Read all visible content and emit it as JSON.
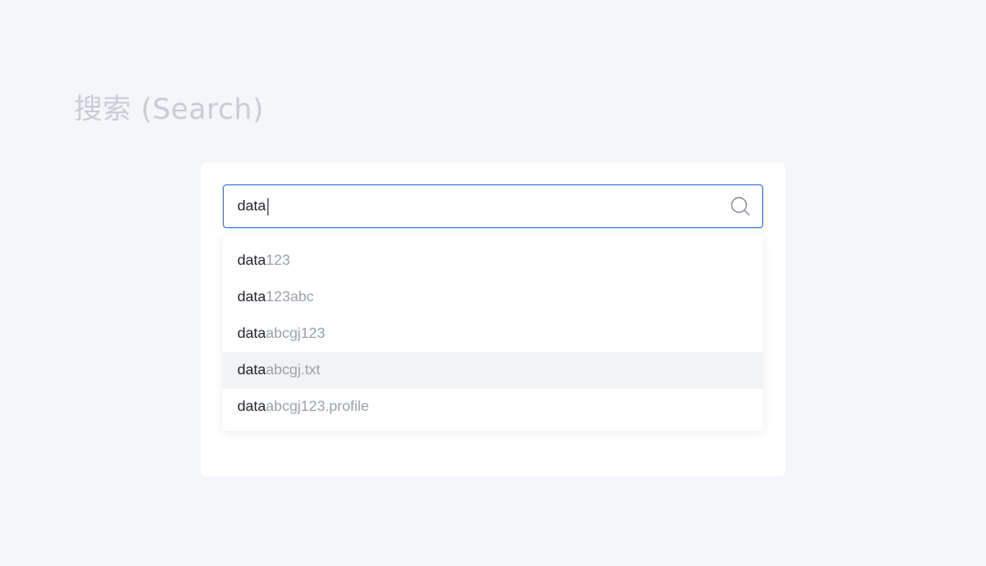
{
  "page": {
    "title": "搜索 (Search)"
  },
  "search": {
    "value": "data",
    "icon": "search-icon"
  },
  "dropdown": {
    "highlighted_index": 3,
    "options": [
      {
        "match": "data",
        "rest": "123"
      },
      {
        "match": "data",
        "rest": "123abc"
      },
      {
        "match": "data",
        "rest": "abcgj123"
      },
      {
        "match": "data",
        "rest": "abcgj.txt"
      },
      {
        "match": "data",
        "rest": "abcgj123.profile"
      }
    ]
  },
  "colors": {
    "background": "#f4f6fa",
    "accent_border": "#2f6fdb",
    "match_text": "#1f2329",
    "rest_text": "#9aa0a8",
    "title_text": "#c9ccd2",
    "hover_bg": "#f2f3f5"
  }
}
